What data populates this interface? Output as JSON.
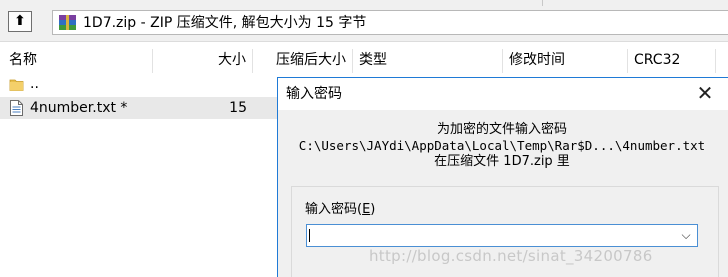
{
  "address_bar": {
    "up_button_glyph": "⬆",
    "path": "1D7.zip - ZIP 压缩文件, 解包大小为 15 字节"
  },
  "columns": {
    "name": "名称",
    "size": "大小",
    "packed": "压缩后大小",
    "type": "类型",
    "modified": "修改时间",
    "crc": "CRC32"
  },
  "rows": [
    {
      "name": "..",
      "size": "",
      "icon": "folder-up-icon"
    },
    {
      "name": "4number.txt *",
      "size": "15",
      "icon": "text-file-icon"
    }
  ],
  "dialog": {
    "title": "输入密码",
    "close_glyph": "✕",
    "message_line1": "为加密的文件输入密码",
    "message_line2": "C:\\Users\\JAYdi\\AppData\\Local\\Temp\\Rar$D...\\4number.txt",
    "message_line3": "在压缩文件 1D7.zip 里",
    "password_label": "输入密码(",
    "password_label_hotkey": "E",
    "password_label_end": ")",
    "password_value": "",
    "dropdown_glyph": "⌵"
  },
  "watermark": "http://blog.csdn.net/sinat_34200786",
  "colors": {
    "dialog_border": "#1f7ad6",
    "selected_row": "#e8e8e8",
    "input_focus_border": "#4a8fd4"
  }
}
